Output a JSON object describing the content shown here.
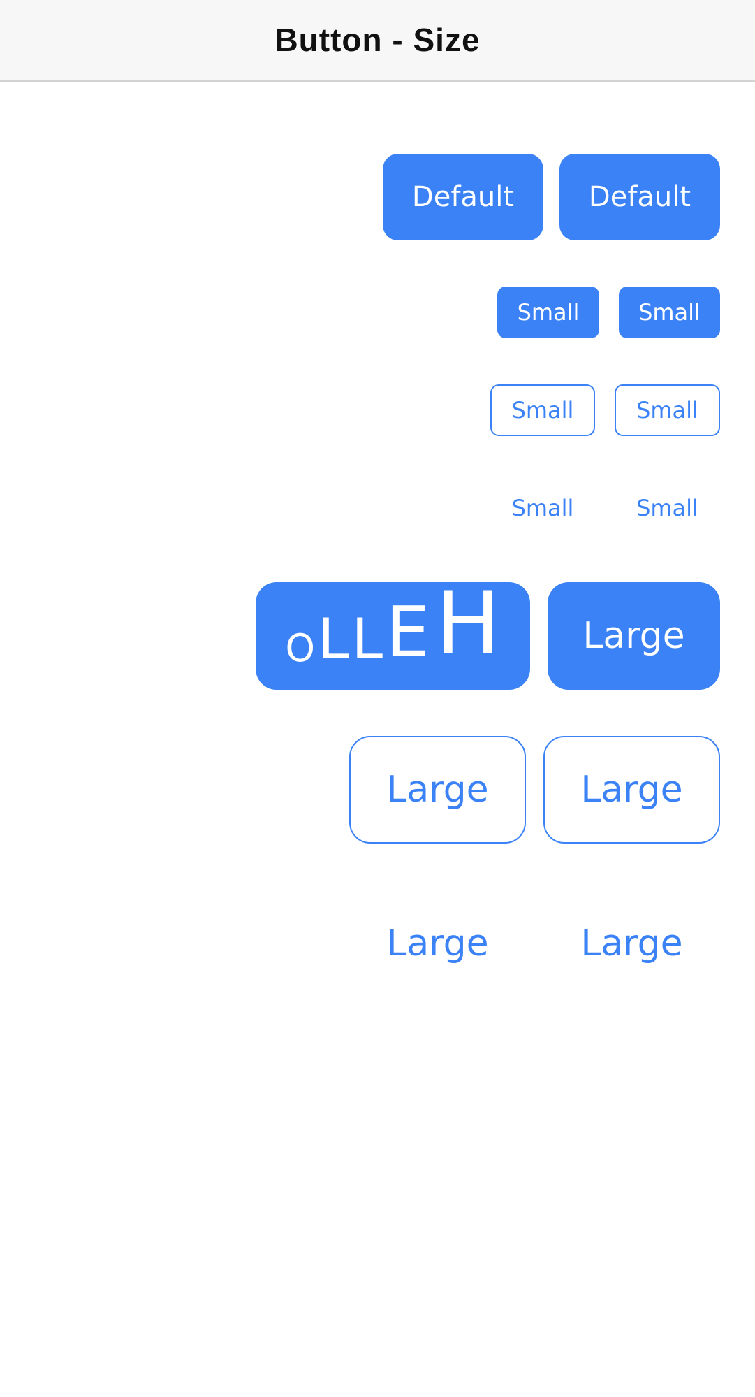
{
  "nav": {
    "title": "Button - Size"
  },
  "rows": {
    "default_filled": [
      "Default",
      "Default"
    ],
    "small_filled": [
      "Small",
      "Small"
    ],
    "small_outline": [
      "Small",
      "Small"
    ],
    "small_text": [
      "Small",
      "Small"
    ],
    "large_filled": {
      "reversed_label_parts": [
        "O",
        "L",
        "L",
        "E",
        "H"
      ],
      "label": "Large"
    },
    "large_outline": [
      "Large",
      "Large"
    ],
    "large_text": [
      "Large",
      "Large"
    ]
  },
  "colors": {
    "accent": "#3b82f6",
    "nav_bg": "#f7f7f7",
    "divider": "#d3d3d3"
  }
}
